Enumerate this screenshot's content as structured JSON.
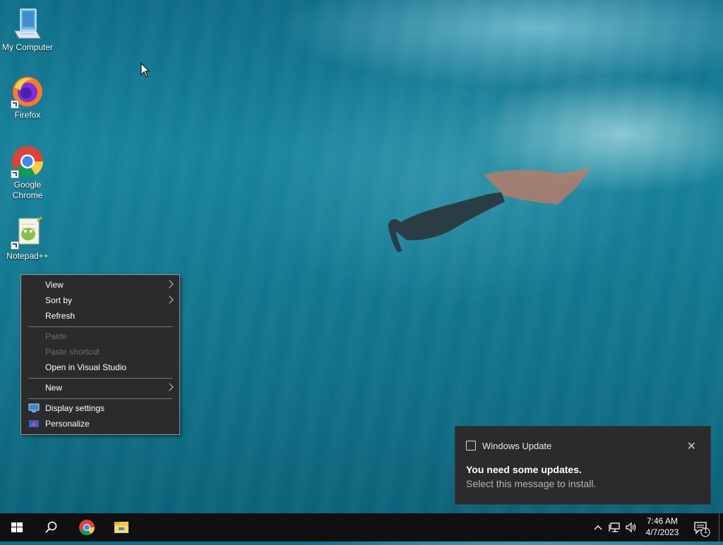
{
  "desktop": {
    "icons": [
      {
        "label": "My Computer",
        "icon": "computer-icon"
      },
      {
        "label": "Firefox",
        "icon": "firefox-icon"
      },
      {
        "label": "Google Chrome",
        "icon": "chrome-icon"
      },
      {
        "label": "Notepad++",
        "icon": "notepadpp-icon"
      }
    ]
  },
  "context_menu": {
    "items": [
      {
        "label": "View",
        "submenu": true,
        "disabled": false
      },
      {
        "label": "Sort by",
        "submenu": true,
        "disabled": false
      },
      {
        "label": "Refresh",
        "submenu": false,
        "disabled": false
      },
      {
        "label": "Paste",
        "submenu": false,
        "disabled": true
      },
      {
        "label": "Paste shortcut",
        "submenu": false,
        "disabled": true
      },
      {
        "label": "Open in Visual Studio",
        "submenu": false,
        "disabled": false
      },
      {
        "label": "New",
        "submenu": true,
        "disabled": false
      },
      {
        "label": "Display settings",
        "submenu": false,
        "disabled": false,
        "icon": "display-icon"
      },
      {
        "label": "Personalize",
        "submenu": false,
        "disabled": false,
        "icon": "personalize-icon"
      }
    ]
  },
  "toast": {
    "app_name": "Windows Update",
    "title": "You need some updates.",
    "body": "Select this message to install.",
    "close_glyph": "✕"
  },
  "taskbar": {
    "time": "7:46 AM",
    "date": "4/7/2023",
    "notification_count": "1",
    "pinned": [
      "windows-start-icon",
      "search-icon",
      "chrome-icon",
      "file-explorer-icon"
    ],
    "tray": [
      "chevron-up-icon",
      "network-icon",
      "volume-icon"
    ]
  },
  "colors": {
    "menu_bg": "#2b2b2b",
    "taskbar_bg": "#101010",
    "disabled_text": "#6d6d6d"
  }
}
